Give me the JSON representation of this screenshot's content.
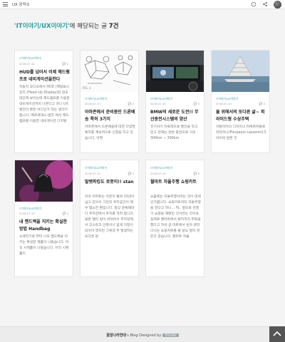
{
  "header": {
    "site_title": "UX 공작소",
    "icons": [
      "menu-icon",
      "compass-icon",
      "share-icon",
      "avatar"
    ]
  },
  "results": {
    "query": "'IT이야기/UX이야기'",
    "suffix": "에 해당되는 글 ",
    "count": "7건"
  },
  "posts": [
    {
      "category": "IT이야기/UX이야기",
      "date": "2018.07.10",
      "comments": "0",
      "title": "HUD를 넘어서 이제 헤드램프로 네비게이션을한다",
      "summary": "자동차 오디오에서 HUD (헤방표시장치 (Head Up Display)란 뭔도 대단해 보이는데 헤드램프를 이용한 네비게이션까지 나온다고 하니 UX 발전이 끝은 어디인가 하는 생각이 듭니다. 메르세데스-벤츠 에서 헤드램프를 이용한 네비게이션 디지털"
    },
    {
      "category": "IT이야기/UX이야기",
      "date": "2018.07.10",
      "comments": "0",
      "title": "아마존에서 준비중인 드론배송 특허 3가지",
      "summary": "아마존에서 드론배송에 대한 다양한 특허를 계속적으로 신청을 하고 있습니다. 어떻"
    },
    {
      "category": "IT이야기/UX이야기",
      "date": "2018.07.10",
      "comments": "0",
      "title": "BMW의 새로운 도전!! 무선충전시스템의 양산",
      "summary": "전기자가 자독적으로 발전을 하고 있고 현재는 완변 충전으로 거의 300km ~ 390km"
    },
    {
      "category": "IT이야기/UX이야기",
      "date": "2018.07.10",
      "comments": "0",
      "title": "물 위에서의 또다른 삶~ 피라미드형 수상주택",
      "summary": "이탈리아의 디자이너 피에르파올로 라자리니(Pierpaolo Lazzarini)가 아이와 일본 건"
    },
    {
      "category": "IT이야기/UX이야기",
      "date": "2018.07.10",
      "comments": "0",
      "title": "내 핸드백을 지키는 확실한 방법 Handbag",
      "summary": "소매치기로 부터 나의 핸드백을 지키는 확실한 제품이 나왔습니다. 아직 시제품이 나왔습니다. 아직 시제품이"
    },
    {
      "category": "IT이야기/UX이야기",
      "date": "2018.07.10",
      "comments": "0",
      "title": "발렛파킹도 로봇이!! stan",
      "summary": "자의 아파트는 지은지 벌써 15년이 넘고 있어서 그런지 주차공간이 매우 협소한 편입니다. 항상 운록때마다 주차장에서 주차를 하려 합니다. 물론 밸리 방이 바뀌어서 주차장에서 코스트코 안쪽이나 넓게 지정이 되어야 겠지만 그렇겠 주 발생하는 또다른 문"
    },
    {
      "category": "IT이야기/UX이야기",
      "date": "2018.07.10",
      "comments": "0",
      "title": "월마트 자율주행 쇼핑카트",
      "summary": "요즘에는 자율주행이라는 것이 대세인가봅니다. 쇼핑카트까지 자율주행을 한다고 하니... 뭐.. 앞으로 언젠가 쇼핑을 해봤던 것이라는 것이죠. 실제로 월마트에서 특허까지 취득을 했다고 하네 공 마트에서 혼자 굴러다니는 쇼핑카트를 볼 날도 멀지 않은것 같습니다. 월마트 자율"
    }
  ],
  "footer": {
    "owner": "꿀알나라연대",
    "text": "'s Blog Designed by ",
    "badge": "TISTORY"
  }
}
